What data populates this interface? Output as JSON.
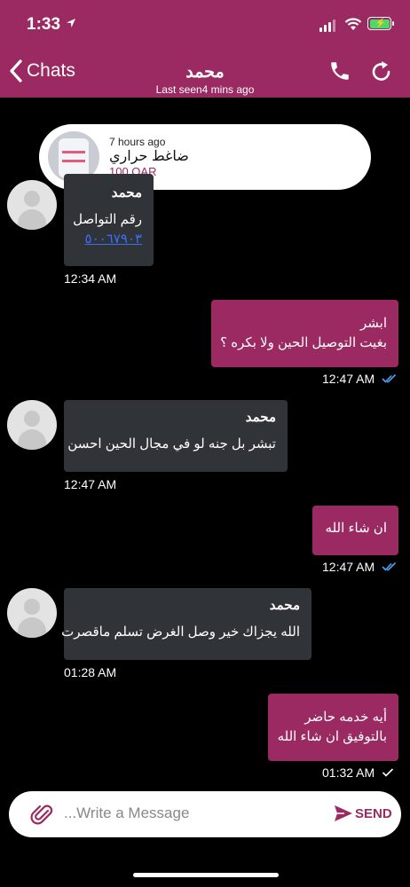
{
  "status_bar": {
    "time": "1:33"
  },
  "header": {
    "back_label": "Chats",
    "title": "محمد",
    "subtitle": "Last seen4 mins ago"
  },
  "product": {
    "time": "7 hours ago",
    "name": "ضاغط حراري",
    "price": "100 QAR"
  },
  "messages": [
    {
      "direction": "in",
      "sender": "محمد",
      "lines": [
        "رقم التواصل",
        "٥٠٠٦٧٩٠٣"
      ],
      "time": "12:34 AM"
    },
    {
      "direction": "out",
      "lines": [
        "ابشر",
        "بغيت التوصيل الحين ولا بكره ؟"
      ],
      "time": "12:47 AM",
      "status": "read"
    },
    {
      "direction": "in",
      "sender": "محمد",
      "lines": [
        "تبشر بل جنه لو في مجال الحين احسن"
      ],
      "time": "12:47 AM"
    },
    {
      "direction": "out",
      "lines": [
        "ان شاء الله"
      ],
      "time": "12:47 AM",
      "status": "read"
    },
    {
      "direction": "in",
      "sender": "محمد",
      "lines": [
        "الله يجزاك خير وصل الغرض تسلم ماقصرت"
      ],
      "time": "01:28 AM"
    },
    {
      "direction": "out",
      "lines": [
        "أيه خدمه حاضر",
        "بالتوفيق ان شاء الله"
      ],
      "time": "01:32 AM",
      "status": "sent"
    }
  ],
  "composer": {
    "placeholder": "...Write a Message",
    "send_label": "SEND"
  },
  "colors": {
    "brand": "#9c2a62",
    "incoming_bubble": "#303337",
    "read_tick": "#4aa3f0"
  }
}
